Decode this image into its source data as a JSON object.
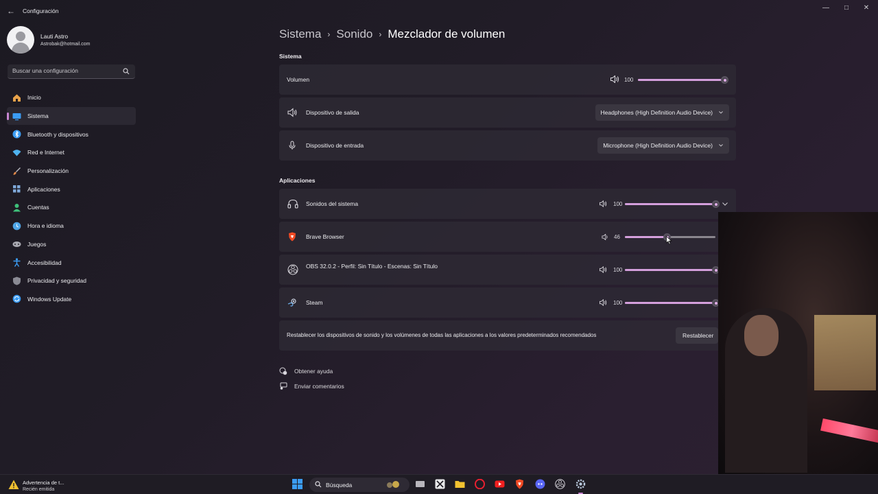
{
  "window": {
    "title": "Configuración"
  },
  "profile": {
    "name": "Lauti Astro",
    "email": "Astrobak@hotmail.com"
  },
  "search": {
    "placeholder": "Buscar una configuración"
  },
  "nav": [
    {
      "label": "Inicio",
      "icon": "home-icon",
      "color": "#e8a24a"
    },
    {
      "label": "Sistema",
      "icon": "system-icon",
      "color": "#3b9cf4",
      "active": true
    },
    {
      "label": "Bluetooth y dispositivos",
      "icon": "bluetooth-icon",
      "color": "#3b9cf4"
    },
    {
      "label": "Red e Internet",
      "icon": "wifi-icon",
      "color": "#4fb3f0"
    },
    {
      "label": "Personalización",
      "icon": "brush-icon",
      "color": "#e0884a"
    },
    {
      "label": "Aplicaciones",
      "icon": "apps-icon",
      "color": "#7fa8d8"
    },
    {
      "label": "Cuentas",
      "icon": "accounts-icon",
      "color": "#3ec07a"
    },
    {
      "label": "Hora e idioma",
      "icon": "globe-icon",
      "color": "#4fa6e8"
    },
    {
      "label": "Juegos",
      "icon": "gamepad-icon",
      "color": "#a8a8b0"
    },
    {
      "label": "Accesibilidad",
      "icon": "accessibility-icon",
      "color": "#3b9cf4"
    },
    {
      "label": "Privacidad y seguridad",
      "icon": "shield-icon",
      "color": "#8a8a94"
    },
    {
      "label": "Windows Update",
      "icon": "update-icon",
      "color": "#3b9cf4"
    }
  ],
  "breadcrumb": {
    "items": [
      "Sistema",
      "Sonido"
    ],
    "current": "Mezclador de volumen"
  },
  "system": {
    "section_label": "Sistema",
    "volume": {
      "label": "Volumen",
      "value": "100",
      "level": 1.0
    },
    "output": {
      "label": "Dispositivo de salida",
      "selected": "Headphones (High Definition Audio Device)"
    },
    "input": {
      "label": "Dispositivo de entrada",
      "selected": "Microphone (High Definition Audio Device)"
    }
  },
  "apps": {
    "section_label": "Aplicaciones",
    "items": [
      {
        "label": "Sonidos del sistema",
        "value": "100",
        "level": 1.0,
        "icon": "headphones-icon"
      },
      {
        "label": "Brave Browser",
        "value": "46",
        "level": 0.46,
        "icon": "brave-icon"
      },
      {
        "label": "OBS 32.0.2 - Perfil: Sin Título - Escenas: Sin Título",
        "value": "100",
        "level": 1.0,
        "icon": "obs-icon"
      },
      {
        "label": "Steam",
        "value": "100",
        "level": 1.0,
        "icon": "steam-icon"
      }
    ]
  },
  "reset": {
    "text": "Restablecer los dispositivos de sonido y los volúmenes de todas las aplicaciones a los valores predeterminados recomendados",
    "button": "Restablecer"
  },
  "links": {
    "help": "Obtener ayuda",
    "feedback": "Enviar comentarios"
  },
  "taskbar": {
    "notification_title": "Advertencia de t...",
    "notification_sub": "Recién emitida",
    "search_label": "Búsqueda",
    "apps": [
      "task-view-icon",
      "capcut-icon",
      "file-explorer-icon",
      "opera-icon",
      "youtube-icon",
      "brave-icon",
      "discord-icon",
      "obs-icon",
      "settings-icon"
    ]
  },
  "colors": {
    "accent": "#d49fdc",
    "nav_active_indicator": "#c986d3"
  }
}
